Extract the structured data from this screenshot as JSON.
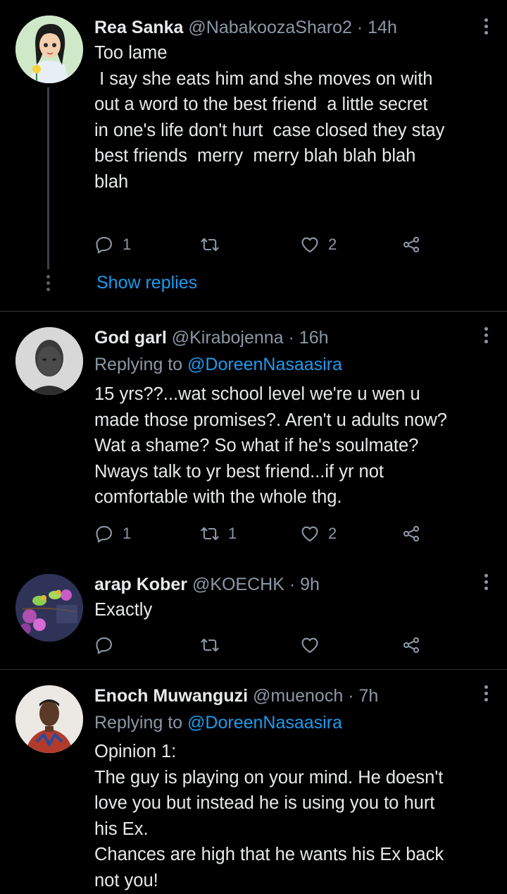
{
  "tweets": [
    {
      "name": "Rea Sanka",
      "handle": "@NabakoozaSharo2",
      "time": "· 14h",
      "replying_label": "",
      "replying_to": "",
      "lines": [
        "Too lame",
        "",
        " I say she eats him and she moves on with",
        "out a word to the best friend  a little secret",
        "in one's life don't hurt  case closed they stay",
        "best friends  merry  merry blah blah blah",
        "blah"
      ],
      "reply_count": "1",
      "retweet_count": "",
      "like_count": "2",
      "show_replies": "Show replies"
    },
    {
      "name": "God garl",
      "handle": "@Kirabojenna",
      "time": "· 16h",
      "replying_label": "Replying to",
      "replying_to": "@DoreenNasaasira",
      "lines": [
        "15 yrs??...wat school level we're u wen u",
        "made those promises?. Aren't u adults now?",
        "Wat a shame? So what if he's soulmate?",
        "Nways talk to yr best friend...if yr not",
        "comfortable with the whole thg."
      ],
      "reply_count": "1",
      "retweet_count": "1",
      "like_count": "2"
    },
    {
      "name": "arap Kober",
      "handle": "@KOECHK",
      "time": "· 9h",
      "lines": [
        "Exactly"
      ],
      "reply_count": "",
      "retweet_count": "",
      "like_count": ""
    },
    {
      "name": "Enoch Muwanguzi",
      "handle": "@muenoch",
      "time": "· 7h",
      "replying_label": "Replying to",
      "replying_to": "@DoreenNasaasira",
      "lines": [
        "Opinion 1:",
        "The guy is playing on your mind. He doesn't",
        "love you but instead he is using you to hurt",
        "his Ex.",
        "Chances are high that he wants his Ex back",
        "not you!"
      ]
    }
  ],
  "icons": {
    "reply": "reply-icon",
    "retweet": "retweet-icon",
    "like": "heart-icon",
    "share": "share-icon",
    "more": "more-vertical-icon"
  },
  "colors": {
    "background": "#000000",
    "text": "#e7e9ea",
    "muted": "#8b98a5",
    "link": "#1d9bf0",
    "divider": "#2f3336"
  }
}
